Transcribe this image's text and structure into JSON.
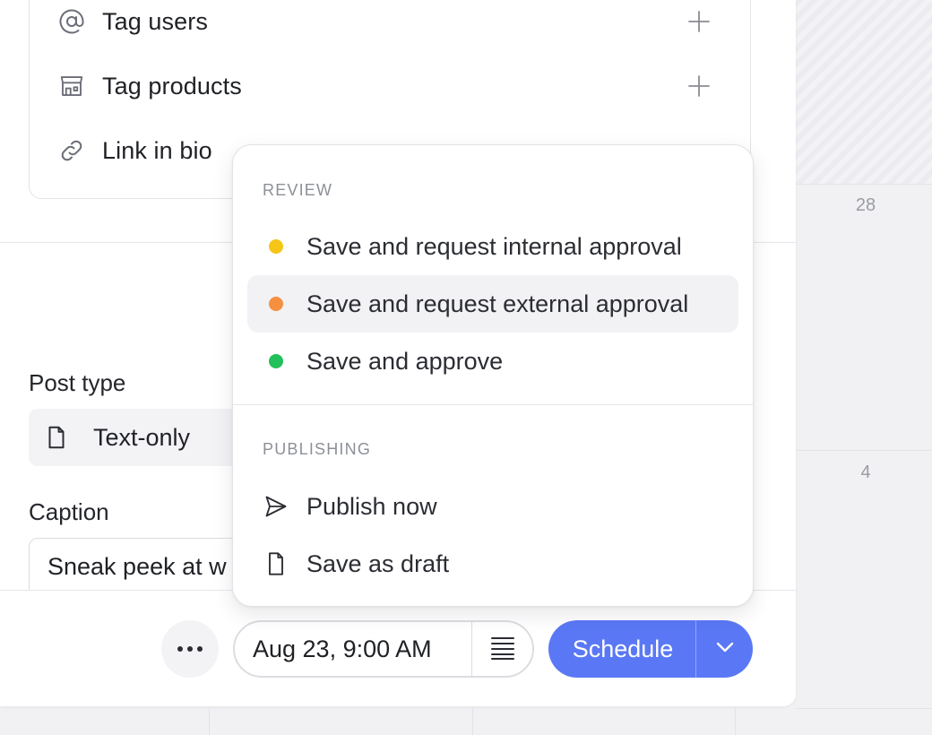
{
  "calendar": {
    "day_a": "28",
    "day_b": "4"
  },
  "options": [
    {
      "label": "Tag users",
      "icon": "at-icon"
    },
    {
      "label": "Tag products",
      "icon": "store-icon"
    },
    {
      "label": "Link in bio",
      "icon": "link-icon"
    }
  ],
  "post_type": {
    "label": "Post type",
    "value": "Text-only"
  },
  "caption": {
    "label": "Caption",
    "value": "Sneak peek at w"
  },
  "footer": {
    "date": "Aug 23, 9:00 AM",
    "schedule_label": "Schedule"
  },
  "menu": {
    "review_heading": "REVIEW",
    "review_items": [
      {
        "label": "Save and request internal approval",
        "color": "#f5c518"
      },
      {
        "label": "Save and request external approval",
        "color": "#f4903f"
      },
      {
        "label": "Save and approve",
        "color": "#22c05a"
      }
    ],
    "publishing_heading": "PUBLISHING",
    "publishing_items": [
      {
        "label": "Publish now",
        "icon": "send-icon"
      },
      {
        "label": "Save as draft",
        "icon": "document-icon"
      }
    ]
  },
  "colors": {
    "accent": "#5a78f5",
    "internal_dot": "#f5c518",
    "external_dot": "#f4903f",
    "approve_dot": "#22c05a"
  }
}
